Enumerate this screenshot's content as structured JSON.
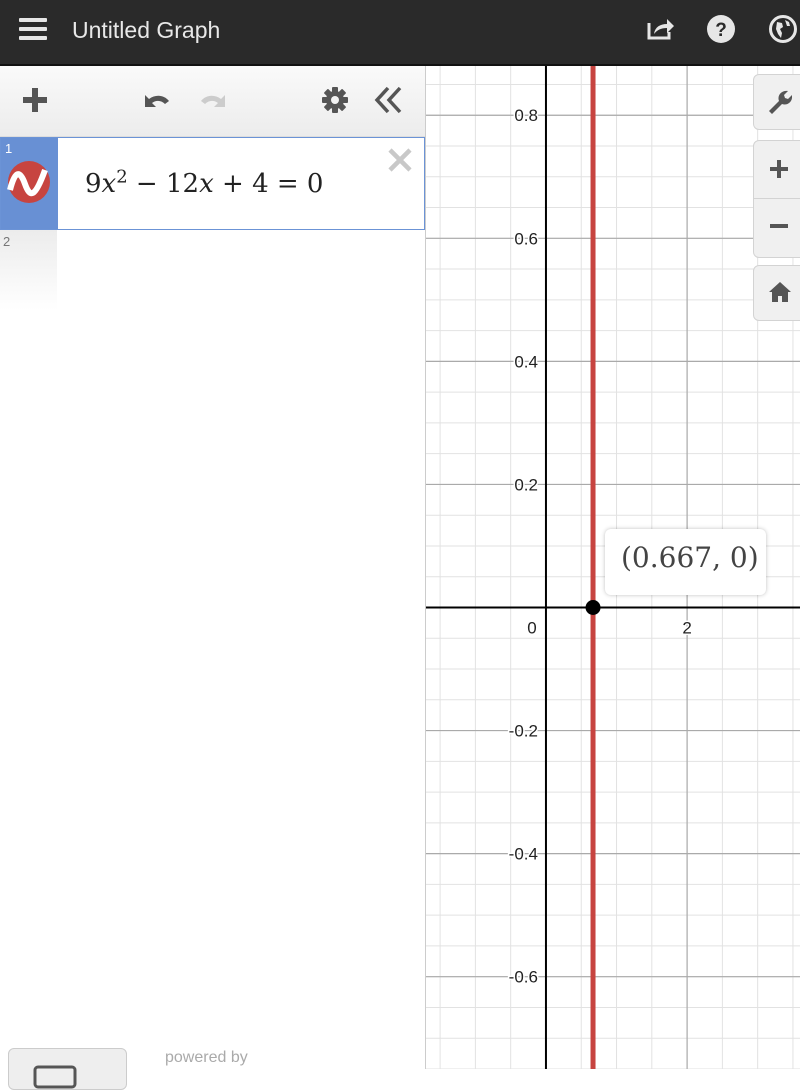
{
  "header": {
    "title": "Untitled Graph",
    "icons": [
      "menu-icon",
      "share-icon",
      "help-icon",
      "globe-icon"
    ]
  },
  "toolbar": {
    "icons": [
      "add-icon",
      "undo-icon",
      "redo-icon",
      "settings-icon",
      "collapse-panel-icon"
    ]
  },
  "expressions": [
    {
      "index": "1",
      "latex": "9x^2 − 12x + 4 = 0",
      "color": "#c74440",
      "icon": "graph-line-icon"
    },
    {
      "index": "2",
      "latex": ""
    }
  ],
  "footer": {
    "powered_by": "powered by",
    "keyboard_icon": "keyboard-icon"
  },
  "graph_controls": [
    "wrench-icon",
    "zoom-in-icon",
    "zoom-out-icon",
    "home-icon"
  ],
  "tooltip": {
    "label": "(0.667, 0)"
  },
  "chart_data": {
    "type": "line",
    "title": "",
    "curves": [
      {
        "name": "9x^2 − 12x + 4 = 0",
        "kind": "vertical-line",
        "x": 0.667,
        "color": "#c74440"
      }
    ],
    "points": [
      {
        "x": 0.667,
        "y": 0,
        "label": "(0.667, 0)",
        "color": "#000000"
      }
    ],
    "x_axis": {
      "range": [
        -1.7,
        3.6
      ],
      "major_step": 2,
      "minor_step": 0.5,
      "tick_labels": [
        "0",
        "2"
      ]
    },
    "y_axis": {
      "range": [
        -0.75,
        0.88
      ],
      "major_step": 0.2,
      "minor_step": 0.05,
      "tick_labels": [
        "0.8",
        "0.6",
        "0.4",
        "0.2",
        "-0.2",
        "-0.4",
        "-0.6"
      ]
    },
    "grid": true,
    "colors": {
      "curve": "#c74440",
      "axis": "#000000",
      "grid_major": "#aaaaaa",
      "grid_minor": "#e2e2e2"
    }
  }
}
